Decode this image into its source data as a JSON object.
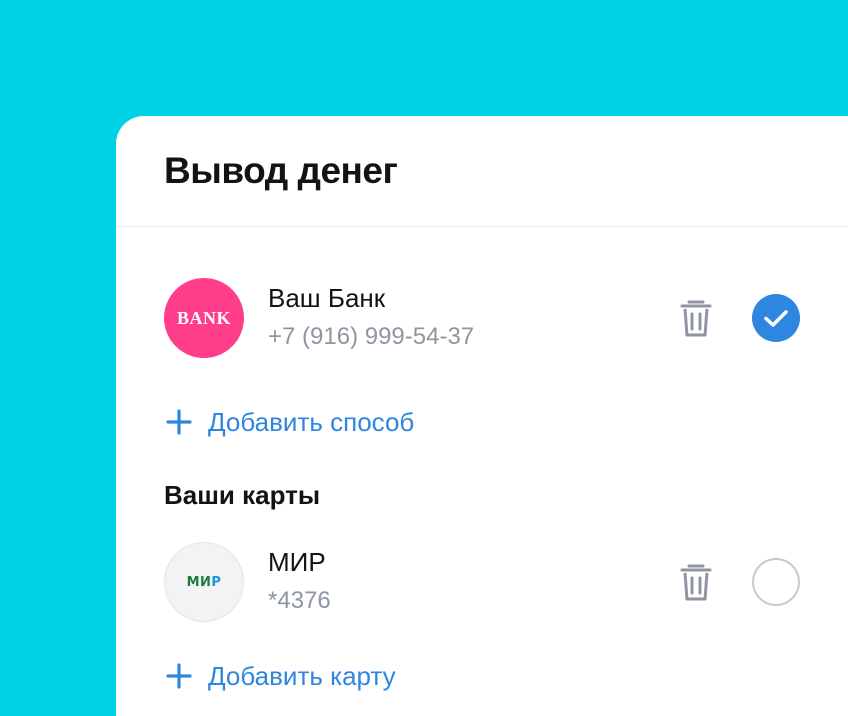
{
  "title": "Вывод денег",
  "methods": [
    {
      "logo_text": "BANK",
      "name": "Ваш Банк",
      "detail": "+7 (916) 999-54-37",
      "selected": true
    }
  ],
  "add_method_label": "Добавить способ",
  "cards_section_title": "Ваши карты",
  "cards": [
    {
      "logo_text_main": "МИ",
      "logo_text_accent": "Р",
      "name": "МИР",
      "detail": "*4376",
      "selected": false
    }
  ],
  "add_card_label": "Добавить карту",
  "colors": {
    "background": "#00D2E6",
    "accent": "#2E86E0",
    "bank_logo": "#FF3D8B",
    "mir_green": "#1F7A3E",
    "muted_text": "#8E96A2"
  },
  "icons": [
    "trash-icon",
    "check-icon",
    "plus-icon"
  ]
}
